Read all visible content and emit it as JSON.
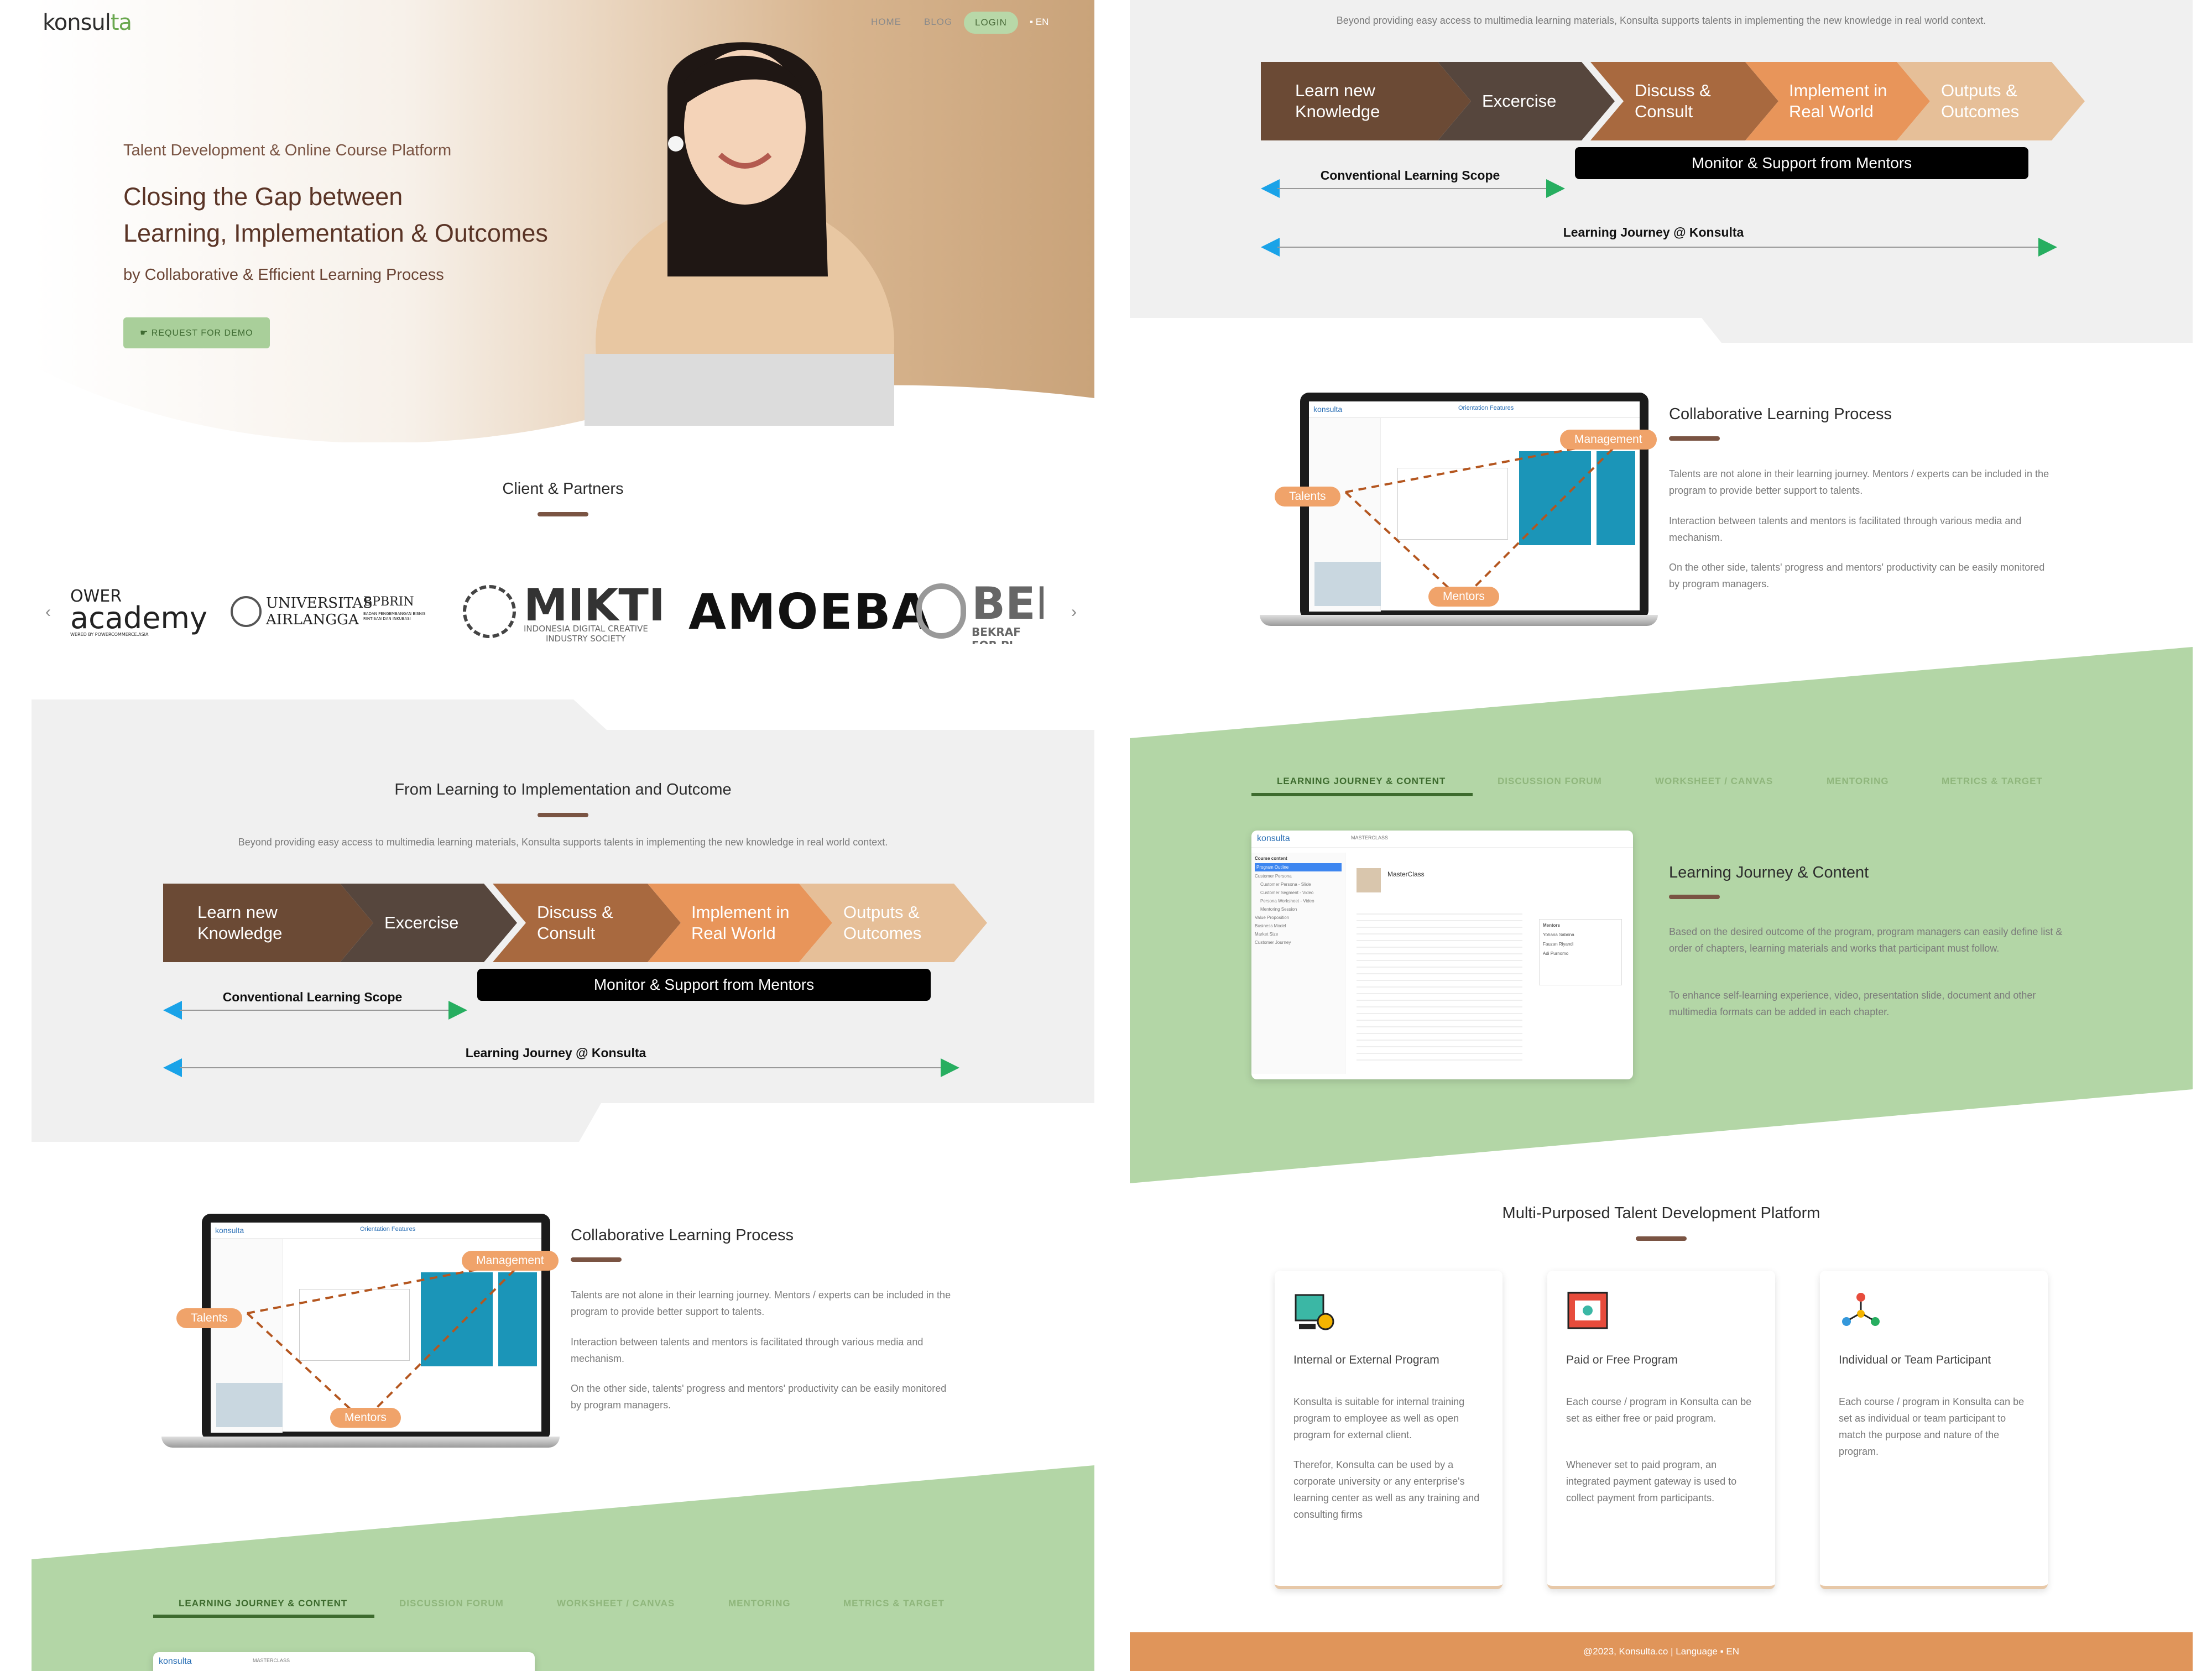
{
  "nav": {
    "logo_main": "konsul",
    "logo_accent": "ta",
    "items": [
      "HOME",
      "BLOG",
      "LOGIN"
    ],
    "lang": "EN"
  },
  "hero": {
    "subtitle": "Talent Development & Online Course Platform",
    "title_line1": "Closing the Gap between",
    "title_line2": "Learning, Implementation & Outcomes",
    "byline": "by Collaborative & Efficient Learning Process",
    "cta": "REQUEST FOR DEMO"
  },
  "partners": {
    "title": "Client & Partners",
    "logos": [
      {
        "line1": "OWER",
        "line2": "academy",
        "line3": "WERED BY POWERCOMMERCE.ASIA"
      },
      {
        "line1": "UNIVERSITAS",
        "line2": "AIRLANGGA",
        "line3": "BPBRIN",
        "line4": "BADAN PENGEMBANGAN BISNIS RINTISAN DAN INKUBASI"
      },
      {
        "line1": "MIKTI",
        "line2": "INDONESIA DIGITAL CREATIVE",
        "line3": "INDUSTRY SOCIETY"
      },
      {
        "line1": "AMOEBA"
      },
      {
        "line1": "BEKI",
        "line2": "BEKRAF FOR PI"
      }
    ],
    "prev": "‹",
    "next": "›"
  },
  "journey": {
    "title": "From Learning to Implementation and Outcome",
    "description": "Beyond providing easy access to multimedia learning materials, Konsulta supports talents in implementing the new knowledge in real world context.",
    "steps": [
      {
        "l1": "Learn new",
        "l2": "Knowledge",
        "color": "#6b4a35"
      },
      {
        "l1": "Excercise",
        "l2": "",
        "color": "#56463d"
      },
      {
        "l1": "Discuss &",
        "l2": "Consult",
        "color": "#a8693f"
      },
      {
        "l1": "Implement in",
        "l2": "Real World",
        "color": "#e8955a"
      },
      {
        "l1": "Outputs &",
        "l2": "Outcomes",
        "color": "#e6bf98"
      }
    ],
    "monitor": "Monitor & Support from Mentors",
    "scope": "Conventional Learning Scope",
    "full": "Learning Journey @ Konsulta"
  },
  "collab": {
    "title": "Collaborative Learning Process",
    "p1": "Talents are not alone in their learning journey. Mentors / experts can be included in the program to provide better support to talents.",
    "p2": "Interaction between talents and mentors is facilitated through various media and mechanism.",
    "p3": "On the other side, talents' progress and mentors' productivity can be easily monitored by program managers.",
    "pills": [
      "Management",
      "Talents",
      "Mentors"
    ],
    "app_brand": "konsulta",
    "app_header": "Orientation Features"
  },
  "tabs": [
    "LEARNING JOURNEY & CONTENT",
    "DISCUSSION FORUM",
    "WORKSHEET / CANVAS",
    "MENTORING",
    "METRICS & TARGET"
  ],
  "learning": {
    "title": "Learning Journey & Content",
    "p1": "Based on the desired outcome of the program, program managers can easily define list & order of chapters, learning materials and works that participant must follow.",
    "p2": "To enhance self-learning experience, video, presentation slide, document and other multimedia formats can be added in each chapter.",
    "app_brand": "konsulta",
    "app_nav": "MASTERCLASS",
    "app_course": "MasterClass",
    "app_menu": [
      "Course content",
      "Program Outline",
      "Customer Persona",
      "Customer Persona - Slide",
      "Customer Segment - Video",
      "Persona Worksheet - Video",
      "Mentoring Session",
      "Value Proposition",
      "Business Model",
      "Market Size",
      "Customer Journey"
    ],
    "app_mentors": "Mentors",
    "mentor_names": [
      "Yohana Sabrina",
      "Fauzan Riyandi",
      "Adi Purnomo"
    ]
  },
  "platform": {
    "title": "Multi-Purposed Talent Development Platform",
    "cards": [
      {
        "title": "Internal or External Program",
        "p1": "Konsulta is suitable for internal training program to employee as well as open program for external client.",
        "p2": "Therefor, Konsulta can be used by a corporate university or any enterprise's learning center as well as any training and consulting firms"
      },
      {
        "title": "Paid or Free Program",
        "p1": "Each course / program in Konsulta can be set as either free or paid program.",
        "p2": "Whenever set to paid program, an integrated payment gateway is used to collect payment from participants."
      },
      {
        "title": "Individual or Team Participant",
        "p1": "Each course / program in Konsulta can be set as individual or team participant to match the purpose and nature of the program.",
        "p2": ""
      }
    ]
  },
  "footer": {
    "text": "@2023, Konsulta.co | Language",
    "lang": "EN"
  },
  "colors": {
    "brown": "#7a5443",
    "green": "#b3d6a6",
    "orange": "#e0955a"
  }
}
